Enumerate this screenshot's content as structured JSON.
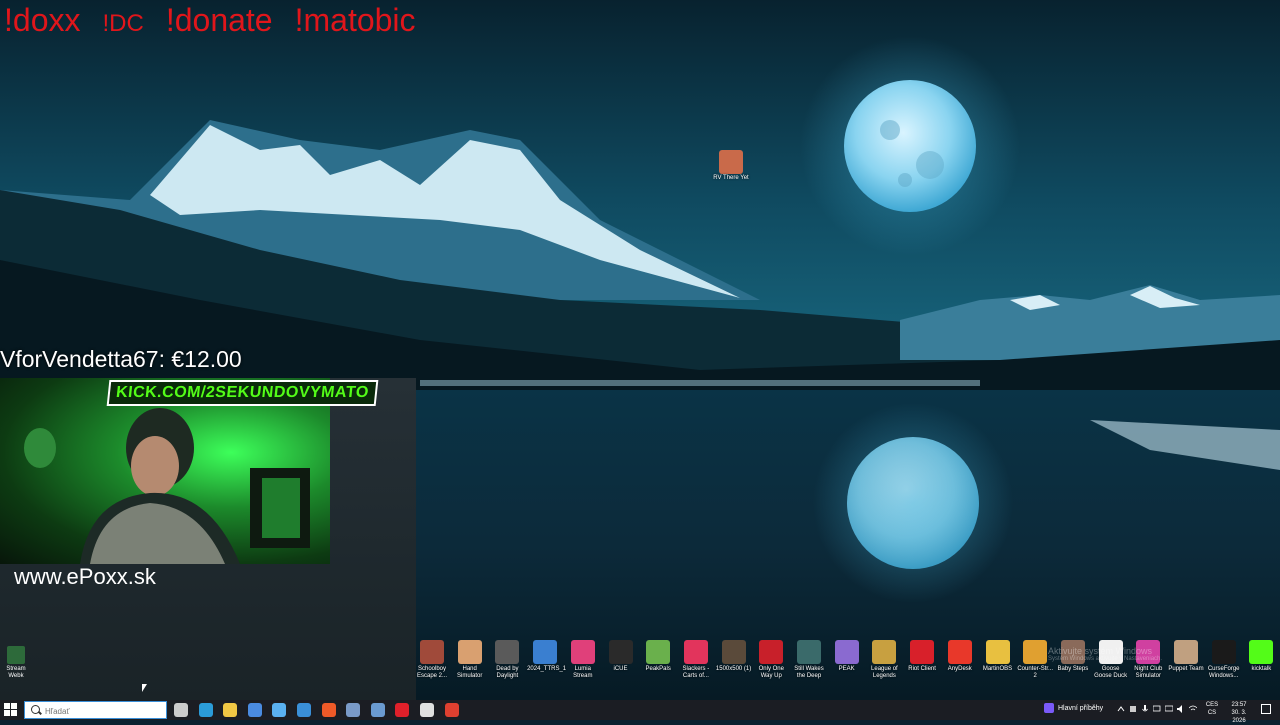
{
  "overlay": {
    "commands": [
      {
        "label": "!doxx",
        "size": "large"
      },
      {
        "label": "!DC",
        "size": "small"
      },
      {
        "label": "!donate",
        "size": "large"
      },
      {
        "label": "!matobic",
        "size": "large"
      }
    ],
    "donation": "VforVendetta67: €12.00",
    "kick_banner": "KICK.COM/2SEKUNDOVYMATO",
    "website": "www.ePoxx.sk"
  },
  "desktop": {
    "rv_icon": {
      "label": "RV There Yet",
      "color": "#c96a4a"
    },
    "left_stub": {
      "label": "Stream Webk"
    },
    "icons": [
      {
        "label": "Schoolboy Escape 2...",
        "color": "#a04a3a"
      },
      {
        "label": "Hand Simulator",
        "color": "#d9a070"
      },
      {
        "label": "Dead by Daylight",
        "color": "#5a5a5a"
      },
      {
        "label": "2024_TTRS_1",
        "color": "#3a7fd0"
      },
      {
        "label": "Lumia Stream",
        "color": "#e0407a"
      },
      {
        "label": "iCUE",
        "color": "#2a2a2a"
      },
      {
        "label": "PeakPals",
        "color": "#6ab04c"
      },
      {
        "label": "Slackers - Carts of...",
        "color": "#e2345c"
      },
      {
        "label": "1500x500 (1)",
        "color": "#5a4a3a"
      },
      {
        "label": "Only One Way Up",
        "color": "#c8202a"
      },
      {
        "label": "Still Wakes the Deep",
        "color": "#3a6a6a"
      },
      {
        "label": "PEAK",
        "color": "#8a6ad0"
      },
      {
        "label": "League of Legends",
        "color": "#c8a040"
      },
      {
        "label": "Riot Client",
        "color": "#d8202a"
      },
      {
        "label": "AnyDesk",
        "color": "#e8382a"
      },
      {
        "label": "MartinOBS",
        "color": "#e8c040"
      },
      {
        "label": "Counter-Str... 2",
        "color": "#e0a030"
      },
      {
        "label": "Baby Steps",
        "color": "#8a6a5a"
      },
      {
        "label": "Goose Goose Duck",
        "color": "#f0f0f0"
      },
      {
        "label": "Night Club Simulator",
        "color": "#d040a0"
      },
      {
        "label": "Puppet Team",
        "color": "#c0a080"
      },
      {
        "label": "CurseForge Windows...",
        "color": "#1a1a1a"
      },
      {
        "label": "kicktalk",
        "color": "#53fc18"
      }
    ],
    "activate_windows": {
      "title": "Aktivujte systém Windows",
      "subtitle": "Systém Windows aktivujte v Nastaveniach."
    }
  },
  "taskbar": {
    "search_placeholder": "Hľadať",
    "pinned_icons": [
      {
        "name": "task-view-icon",
        "color": "#cccccc"
      },
      {
        "name": "edge-icon",
        "color": "#2b9bd8"
      },
      {
        "name": "file-explorer-icon",
        "color": "#f2c744"
      },
      {
        "name": "store-icon",
        "color": "#4a8be0"
      },
      {
        "name": "copilot-icon",
        "color": "#5ab0f0"
      },
      {
        "name": "mail-icon",
        "color": "#3a8fd8"
      },
      {
        "name": "brave-icon",
        "color": "#f05a28"
      },
      {
        "name": "app-icon",
        "color": "#7a9ac8"
      },
      {
        "name": "steam-icon",
        "color": "#6a9ad0"
      },
      {
        "name": "opera-icon",
        "color": "#e0202a"
      },
      {
        "name": "obs-icon",
        "color": "#e0e0e0"
      },
      {
        "name": "chrome-icon",
        "color": "#e04030"
      }
    ],
    "stories_label": "Hlavní příběhy",
    "language": {
      "line1": "CES",
      "line2": "CS"
    },
    "clock": {
      "time": "23:57",
      "date": "30. 3. 2026"
    }
  }
}
